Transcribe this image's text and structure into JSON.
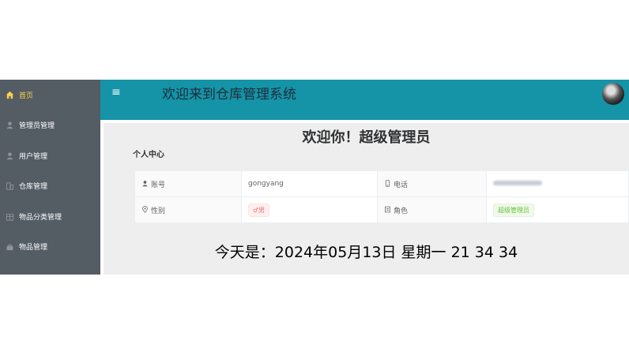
{
  "sidebar": {
    "items": [
      {
        "label": "首页",
        "icon": "home-icon",
        "active": true
      },
      {
        "label": "管理员管理",
        "icon": "user-icon",
        "active": false
      },
      {
        "label": "用户管理",
        "icon": "user-icon",
        "active": false
      },
      {
        "label": "仓库管理",
        "icon": "warehouse-icon",
        "active": false
      },
      {
        "label": "物品分类管理",
        "icon": "box-icon",
        "active": false
      },
      {
        "label": "物品管理",
        "icon": "bag-icon",
        "active": false
      }
    ],
    "active_color": "#ffd04b",
    "background": "#545c64"
  },
  "header": {
    "title": "欢迎来到仓库管理系统",
    "menu_icon": "≡",
    "background": "#1494a6"
  },
  "main": {
    "welcome": "欢迎你！超级管理员",
    "section_title": "个人中心",
    "info": {
      "account_label": "账号",
      "account_value": "gongyang",
      "phone_label": "电话",
      "gender_label": "性别",
      "gender_value": "♂男",
      "role_label": "角色",
      "role_value": "超级管理员"
    },
    "date_line": "今天是：2024年05月13日 星期一 21 34 34"
  }
}
